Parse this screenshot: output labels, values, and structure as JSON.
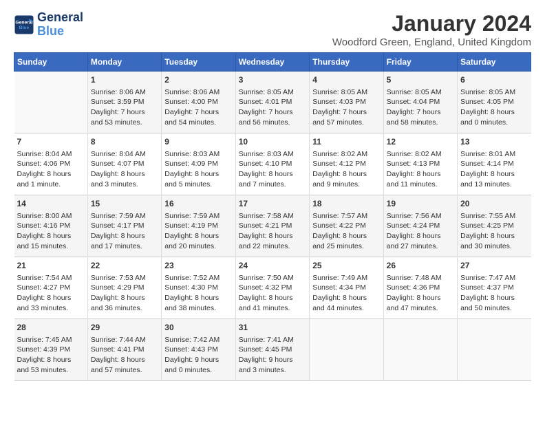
{
  "header": {
    "logo_line1": "General",
    "logo_line2": "Blue",
    "month": "January 2024",
    "location": "Woodford Green, England, United Kingdom"
  },
  "days_of_week": [
    "Sunday",
    "Monday",
    "Tuesday",
    "Wednesday",
    "Thursday",
    "Friday",
    "Saturday"
  ],
  "weeks": [
    {
      "days": [
        {
          "number": "",
          "info": ""
        },
        {
          "number": "1",
          "info": "Sunrise: 8:06 AM\nSunset: 3:59 PM\nDaylight: 7 hours\nand 53 minutes."
        },
        {
          "number": "2",
          "info": "Sunrise: 8:06 AM\nSunset: 4:00 PM\nDaylight: 7 hours\nand 54 minutes."
        },
        {
          "number": "3",
          "info": "Sunrise: 8:05 AM\nSunset: 4:01 PM\nDaylight: 7 hours\nand 56 minutes."
        },
        {
          "number": "4",
          "info": "Sunrise: 8:05 AM\nSunset: 4:03 PM\nDaylight: 7 hours\nand 57 minutes."
        },
        {
          "number": "5",
          "info": "Sunrise: 8:05 AM\nSunset: 4:04 PM\nDaylight: 7 hours\nand 58 minutes."
        },
        {
          "number": "6",
          "info": "Sunrise: 8:05 AM\nSunset: 4:05 PM\nDaylight: 8 hours\nand 0 minutes."
        }
      ]
    },
    {
      "days": [
        {
          "number": "7",
          "info": "Sunrise: 8:04 AM\nSunset: 4:06 PM\nDaylight: 8 hours\nand 1 minute."
        },
        {
          "number": "8",
          "info": "Sunrise: 8:04 AM\nSunset: 4:07 PM\nDaylight: 8 hours\nand 3 minutes."
        },
        {
          "number": "9",
          "info": "Sunrise: 8:03 AM\nSunset: 4:09 PM\nDaylight: 8 hours\nand 5 minutes."
        },
        {
          "number": "10",
          "info": "Sunrise: 8:03 AM\nSunset: 4:10 PM\nDaylight: 8 hours\nand 7 minutes."
        },
        {
          "number": "11",
          "info": "Sunrise: 8:02 AM\nSunset: 4:12 PM\nDaylight: 8 hours\nand 9 minutes."
        },
        {
          "number": "12",
          "info": "Sunrise: 8:02 AM\nSunset: 4:13 PM\nDaylight: 8 hours\nand 11 minutes."
        },
        {
          "number": "13",
          "info": "Sunrise: 8:01 AM\nSunset: 4:14 PM\nDaylight: 8 hours\nand 13 minutes."
        }
      ]
    },
    {
      "days": [
        {
          "number": "14",
          "info": "Sunrise: 8:00 AM\nSunset: 4:16 PM\nDaylight: 8 hours\nand 15 minutes."
        },
        {
          "number": "15",
          "info": "Sunrise: 7:59 AM\nSunset: 4:17 PM\nDaylight: 8 hours\nand 17 minutes."
        },
        {
          "number": "16",
          "info": "Sunrise: 7:59 AM\nSunset: 4:19 PM\nDaylight: 8 hours\nand 20 minutes."
        },
        {
          "number": "17",
          "info": "Sunrise: 7:58 AM\nSunset: 4:21 PM\nDaylight: 8 hours\nand 22 minutes."
        },
        {
          "number": "18",
          "info": "Sunrise: 7:57 AM\nSunset: 4:22 PM\nDaylight: 8 hours\nand 25 minutes."
        },
        {
          "number": "19",
          "info": "Sunrise: 7:56 AM\nSunset: 4:24 PM\nDaylight: 8 hours\nand 27 minutes."
        },
        {
          "number": "20",
          "info": "Sunrise: 7:55 AM\nSunset: 4:25 PM\nDaylight: 8 hours\nand 30 minutes."
        }
      ]
    },
    {
      "days": [
        {
          "number": "21",
          "info": "Sunrise: 7:54 AM\nSunset: 4:27 PM\nDaylight: 8 hours\nand 33 minutes."
        },
        {
          "number": "22",
          "info": "Sunrise: 7:53 AM\nSunset: 4:29 PM\nDaylight: 8 hours\nand 36 minutes."
        },
        {
          "number": "23",
          "info": "Sunrise: 7:52 AM\nSunset: 4:30 PM\nDaylight: 8 hours\nand 38 minutes."
        },
        {
          "number": "24",
          "info": "Sunrise: 7:50 AM\nSunset: 4:32 PM\nDaylight: 8 hours\nand 41 minutes."
        },
        {
          "number": "25",
          "info": "Sunrise: 7:49 AM\nSunset: 4:34 PM\nDaylight: 8 hours\nand 44 minutes."
        },
        {
          "number": "26",
          "info": "Sunrise: 7:48 AM\nSunset: 4:36 PM\nDaylight: 8 hours\nand 47 minutes."
        },
        {
          "number": "27",
          "info": "Sunrise: 7:47 AM\nSunset: 4:37 PM\nDaylight: 8 hours\nand 50 minutes."
        }
      ]
    },
    {
      "days": [
        {
          "number": "28",
          "info": "Sunrise: 7:45 AM\nSunset: 4:39 PM\nDaylight: 8 hours\nand 53 minutes."
        },
        {
          "number": "29",
          "info": "Sunrise: 7:44 AM\nSunset: 4:41 PM\nDaylight: 8 hours\nand 57 minutes."
        },
        {
          "number": "30",
          "info": "Sunrise: 7:42 AM\nSunset: 4:43 PM\nDaylight: 9 hours\nand 0 minutes."
        },
        {
          "number": "31",
          "info": "Sunrise: 7:41 AM\nSunset: 4:45 PM\nDaylight: 9 hours\nand 3 minutes."
        },
        {
          "number": "",
          "info": ""
        },
        {
          "number": "",
          "info": ""
        },
        {
          "number": "",
          "info": ""
        }
      ]
    }
  ]
}
